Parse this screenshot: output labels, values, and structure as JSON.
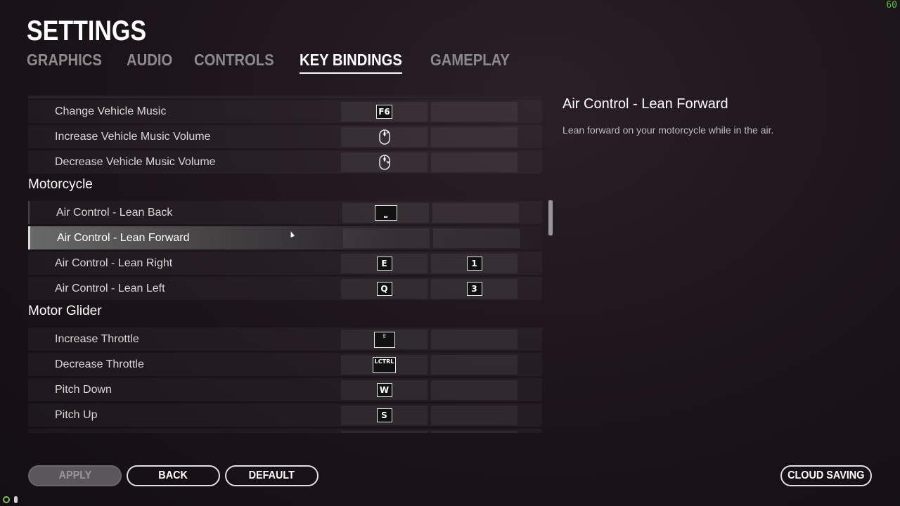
{
  "fps": "60",
  "page_title": "SETTINGS",
  "tabs": [
    {
      "label": "GRAPHICS",
      "active": false
    },
    {
      "label": "AUDIO",
      "active": false
    },
    {
      "label": "CONTROLS",
      "active": false
    },
    {
      "label": "KEY BINDINGS",
      "active": true
    },
    {
      "label": "GAMEPLAY",
      "active": false
    }
  ],
  "bindings": {
    "rows": [
      {
        "type": "row",
        "label": "Change Vehicle Music",
        "key1": "F6",
        "key2": ""
      },
      {
        "type": "row",
        "label": "Increase Vehicle Music Volume",
        "key1": "mouse-wheel-up-icon",
        "key2": ""
      },
      {
        "type": "row",
        "label": "Decrease Vehicle Music Volume",
        "key1": "mouse-wheel-down-icon",
        "key2": ""
      },
      {
        "type": "section",
        "label": "Motorcycle"
      },
      {
        "type": "row",
        "label": "Air Control - Lean Back",
        "key1": "⎵",
        "key2": ""
      },
      {
        "type": "row",
        "label": "Air Control - Lean Forward",
        "key1": "",
        "key2": "",
        "selected": true
      },
      {
        "type": "row",
        "label": "Air Control - Lean Right",
        "key1": "E",
        "key2": "1"
      },
      {
        "type": "row",
        "label": "Air Control - Lean Left",
        "key1": "Q",
        "key2": "3"
      },
      {
        "type": "section",
        "label": "Motor Glider"
      },
      {
        "type": "row",
        "label": "Increase Throttle",
        "key1": "⇧",
        "key2": ""
      },
      {
        "type": "row",
        "label": "Decrease Throttle",
        "key1": "LCTRL",
        "key2": ""
      },
      {
        "type": "row",
        "label": "Pitch Down",
        "key1": "W",
        "key2": ""
      },
      {
        "type": "row",
        "label": "Pitch Up",
        "key1": "S",
        "key2": ""
      }
    ]
  },
  "detail": {
    "title": "Air Control - Lean Forward",
    "description": "Lean forward on your motorcycle while in the air."
  },
  "buttons": {
    "apply": "APPLY",
    "back": "BACK",
    "default": "DEFAULT",
    "cloud_saving": "CLOUD SAVING"
  },
  "colors": {
    "background": "#1b1419",
    "accent": "#ffffff",
    "fps": "#5fbf3f"
  }
}
